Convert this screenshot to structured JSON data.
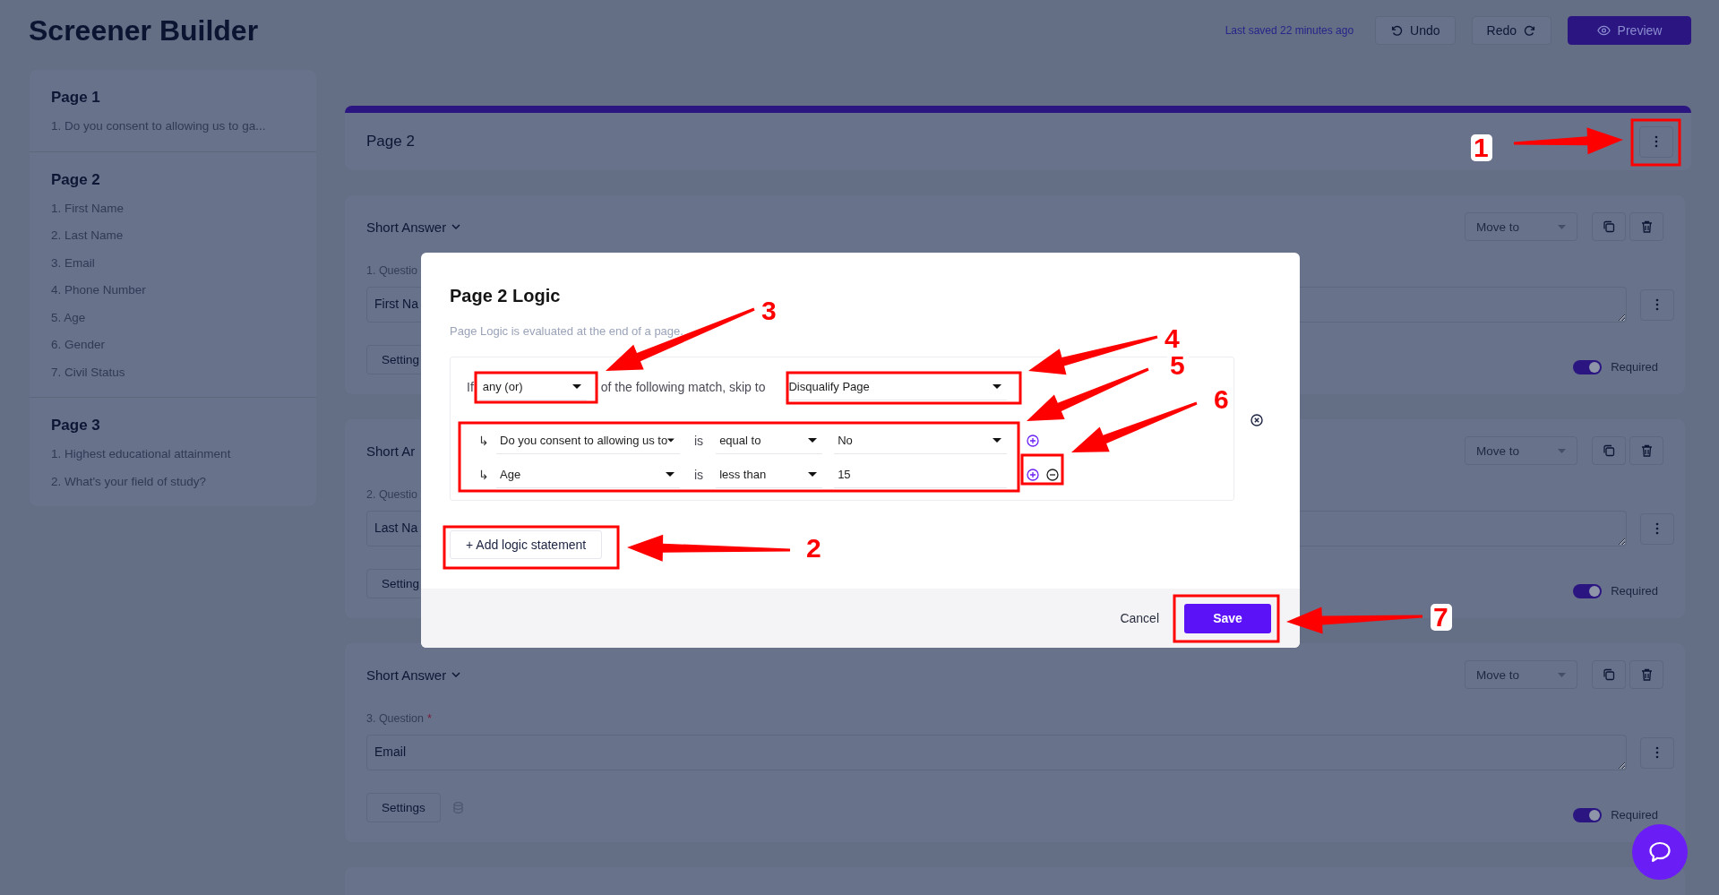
{
  "header": {
    "title": "Screener Builder",
    "last_saved": "Last saved 22 minutes ago",
    "buttons": [
      {
        "label": "Undo",
        "kind": "undo"
      },
      {
        "label": "Redo",
        "kind": "redo"
      },
      {
        "label": "Preview",
        "kind": "preview"
      }
    ]
  },
  "sidebar": {
    "pages": [
      {
        "title": "Page 1",
        "questions": [
          "1. Do you consent to allowing us to ga..."
        ]
      },
      {
        "title": "Page 2",
        "questions": [
          "1. First Name",
          "2. Last Name",
          "3. Email",
          "4. Phone Number",
          "5. Age",
          "6. Gender",
          "7. Civil Status"
        ]
      },
      {
        "title": "Page 3",
        "questions": [
          "1. Highest educational attainment",
          "2. What's your field of study?"
        ]
      }
    ]
  },
  "page_header": {
    "title": "Page 2"
  },
  "questions": [
    {
      "type": "Short Answer",
      "chevron": true,
      "label": "1. Questio",
      "value": "First Na",
      "settings": "Setting",
      "data_icon": false,
      "move_to": "Move to",
      "required": true,
      "required_label": "Required"
    },
    {
      "type": "Short Ar",
      "chevron": false,
      "label": "2. Questio",
      "value": "Last Na",
      "settings": "Setting",
      "data_icon": false,
      "move_to": "Move to",
      "required": true,
      "required_label": "Required"
    },
    {
      "type": "Short Answer",
      "chevron": true,
      "label": "3. Question",
      "required_mark": "*",
      "value": "Email",
      "settings": "Settings",
      "data_icon": true,
      "move_to": "Move to",
      "required": true,
      "required_label": "Required"
    }
  ],
  "modal": {
    "title": "Page 2 Logic",
    "description": "Page Logic is evaluated at the end of a page.",
    "statement": {
      "if_label": "If",
      "match": "any (or)",
      "middle": "of the following match, skip to",
      "target": "Disqualify Page",
      "conditions": [
        {
          "arrow": "↳",
          "question": "Do you consent to allowing us to",
          "operator_label": "is",
          "operator": "equal to",
          "value": "No",
          "kind": "select",
          "actions": [
            {
              "kind": "add"
            }
          ]
        },
        {
          "arrow": "↳",
          "question": "Age",
          "operator_label": "is",
          "operator": "less than",
          "value": "15",
          "kind": "input",
          "actions": [
            {
              "kind": "add"
            },
            {
              "kind": "remove"
            }
          ]
        }
      ]
    },
    "add_button": "+ Add logic statement",
    "cancel": "Cancel",
    "save": "Save"
  },
  "annotations": [
    {
      "label": "1"
    },
    {
      "label": "2"
    },
    {
      "label": "3"
    },
    {
      "label": "4"
    },
    {
      "label": "5"
    },
    {
      "label": "6"
    },
    {
      "label": "7"
    }
  ]
}
